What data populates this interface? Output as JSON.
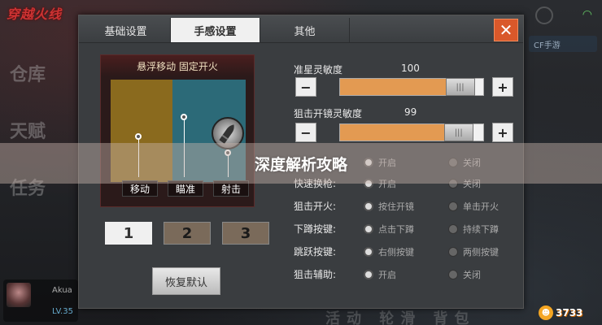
{
  "tabs": [
    {
      "label": "基础设置"
    },
    {
      "label": "手感设置"
    },
    {
      "label": "其他"
    }
  ],
  "close_label": "✕",
  "preview": {
    "title": "悬浮移动 固定开火",
    "zones": [
      "移动",
      "瞄准",
      "射击"
    ]
  },
  "presets": [
    "1",
    "2",
    "3"
  ],
  "reset_label": "恢复默认",
  "sliders": [
    {
      "label": "准星灵敏度",
      "value": "100",
      "fill": 0.93
    },
    {
      "label": "狙击开镜灵敏度",
      "value": "99",
      "fill": 0.92
    }
  ],
  "minus_label": "−",
  "plus_label": "+",
  "thumb_glyph": "|||",
  "options": [
    {
      "label": "",
      "a": "开启",
      "b": "关闭",
      "selected": "a"
    },
    {
      "label": "快速换枪:",
      "a": "开启",
      "b": "关闭",
      "selected": "a"
    },
    {
      "label": "狙击开火:",
      "a": "按住开镜",
      "b": "单击开火",
      "selected": "a"
    },
    {
      "label": "下蹲按键:",
      "a": "点击下蹲",
      "b": "持续下蹲",
      "selected": "a"
    },
    {
      "label": "跳跃按键:",
      "a": "右侧按键",
      "b": "两侧按键",
      "selected": "a"
    },
    {
      "label": "狙击辅助:",
      "a": "开启",
      "b": "关闭",
      "selected": "a"
    }
  ],
  "banner": "深度解析攻略",
  "background": {
    "logo": "穿越火线",
    "nav": [
      "仓库",
      "天赋",
      "任务"
    ],
    "player_name": "Akua",
    "player_level": "LV.35",
    "cf_button": "CF手游",
    "bottom_text": "活动 轮滑 背包"
  },
  "watermark": "3733",
  "colors": {
    "accent_orange": "#e39a52",
    "close_orange": "#d9582a",
    "zone_move": "#8a6a1e",
    "zone_fire": "#2c6a78"
  }
}
